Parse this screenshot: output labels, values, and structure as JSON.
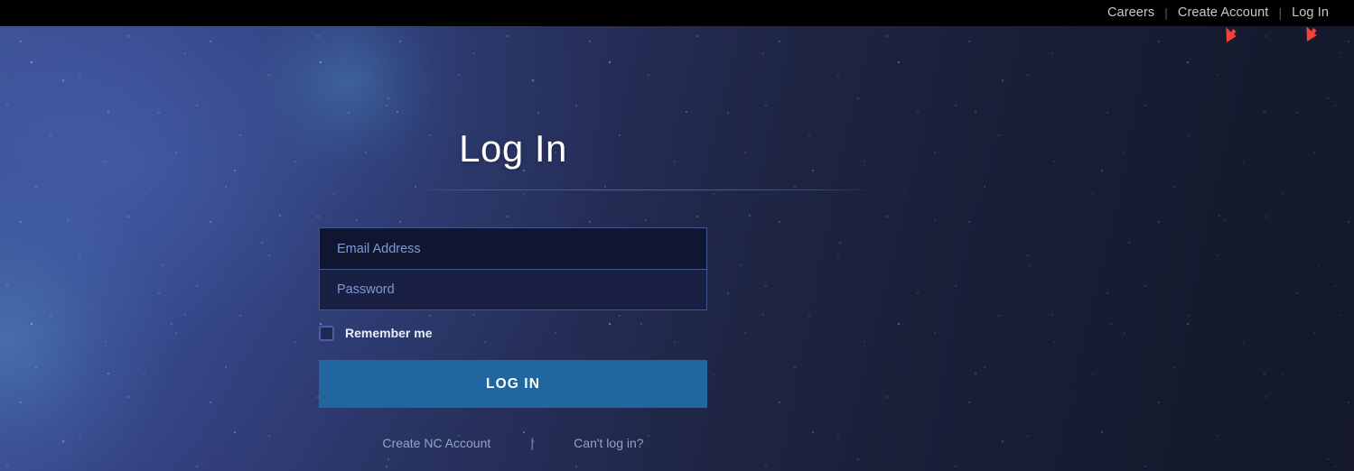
{
  "topnav": {
    "links": [
      {
        "label": "Careers",
        "name": "nav-link-careers"
      },
      {
        "label": "Create Account",
        "name": "nav-link-create-account"
      },
      {
        "label": "Log In",
        "name": "nav-link-log-in"
      }
    ],
    "separator": "|",
    "background_color": "#000000",
    "text_color": "#c8c7c5"
  },
  "page": {
    "title": "Log In",
    "background_description": "starfield-nebula",
    "background_colors": [
      "#3d4d8f",
      "#28325f",
      "#1b2036"
    ]
  },
  "form": {
    "email": {
      "placeholder": "Email Address",
      "value": ""
    },
    "password": {
      "placeholder": "Password",
      "value": ""
    },
    "remember": {
      "label": "Remember me",
      "checked": false
    },
    "submit_label": "LOG IN",
    "submit_color": "#21669e",
    "field_border_color": "#3f5590"
  },
  "footer": {
    "create_account_label": "Create NC Account",
    "separator": "|",
    "cant_log_in_label": "Can't log in?",
    "link_color": "#93a4c4"
  },
  "annotations": {
    "arrow_color": "#f8403a",
    "arrows": [
      {
        "target": "Create Account",
        "name": "annotation-arrow-create-account"
      },
      {
        "target": "Log In",
        "name": "annotation-arrow-log-in"
      }
    ]
  }
}
